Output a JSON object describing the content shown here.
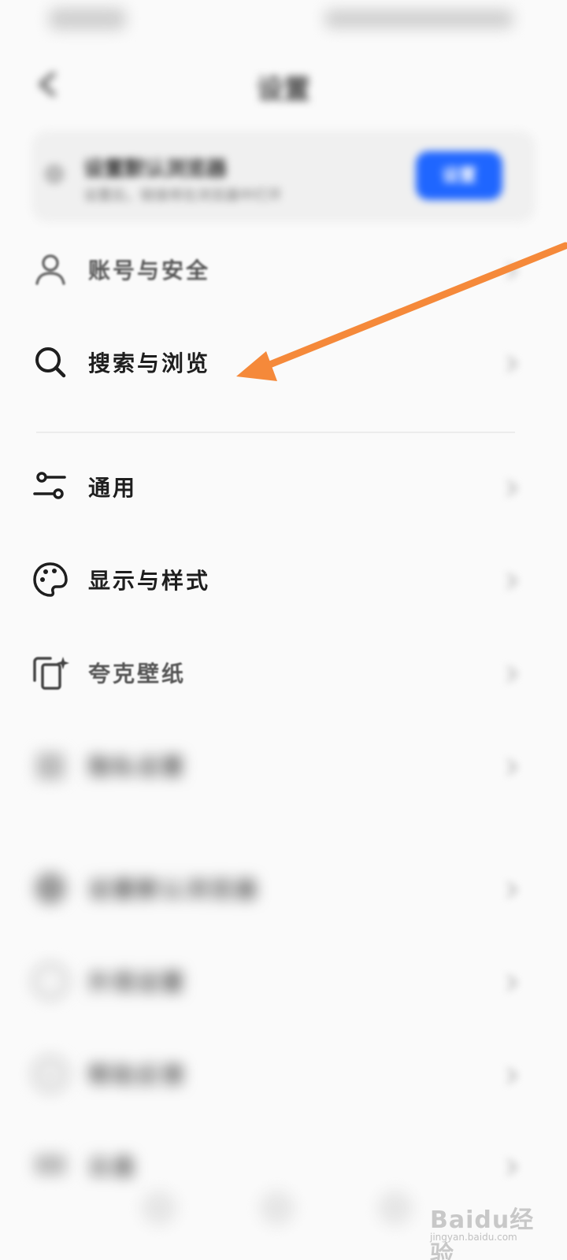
{
  "status_bar": {
    "time": "",
    "icons": ""
  },
  "header": {
    "title": "设置",
    "back_icon": "back-arrow-icon"
  },
  "banner": {
    "title": "设置默认浏览器",
    "subtitle": "设置后，链接将在浏览器中打开",
    "button_label": "设置",
    "button_color": "#1f66ff"
  },
  "menu": {
    "items": [
      {
        "label": "账号与安全",
        "icon": "user-icon"
      },
      {
        "label": "搜索与浏览",
        "icon": "search-icon"
      },
      {
        "label": "通用",
        "icon": "sliders-icon"
      },
      {
        "label": "显示与样式",
        "icon": "palette-icon"
      },
      {
        "label": "夸克壁纸",
        "icon": "wallpaper-icon"
      },
      {
        "label": "隐私设置",
        "icon": "lock-icon"
      },
      {
        "label": "设置默认浏览器",
        "icon": "browser-icon"
      },
      {
        "label": "外观设置",
        "icon": "globe-icon"
      },
      {
        "label": "帮助反馈",
        "icon": "help-icon"
      },
      {
        "label": "云盘",
        "icon": "cloud-icon",
        "value": ""
      }
    ]
  },
  "annotation": {
    "arrow_color": "#f5893a"
  },
  "watermark": {
    "logo": "Baidu经验",
    "url": "jingyan.baidu.com"
  }
}
